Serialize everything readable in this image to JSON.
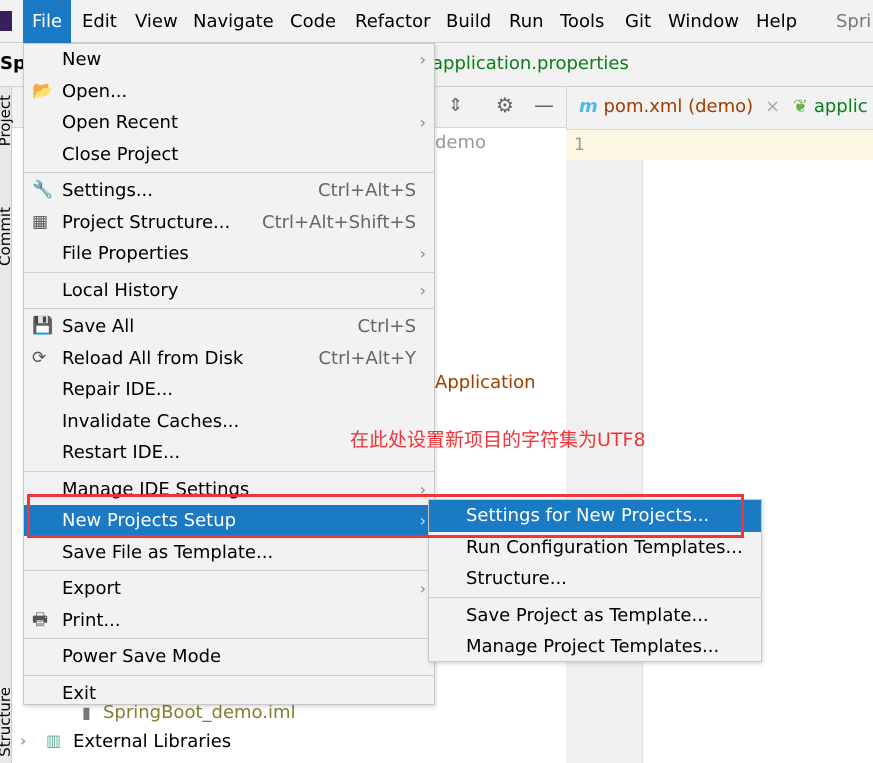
{
  "menubar": {
    "items": [
      "File",
      "Edit",
      "View",
      "Navigate",
      "Code",
      "Refactor",
      "Build",
      "Run",
      "Tools",
      "Git",
      "Window",
      "Help"
    ],
    "active": "File",
    "project_title": "Spri"
  },
  "navbar": {
    "project": "Spr",
    "file": "application.properties"
  },
  "editor": {
    "tabs": [
      {
        "label": "pom.xml (demo)",
        "icon": "maven-m-icon"
      },
      {
        "label": "applic",
        "icon": "spring-leaf-icon"
      }
    ],
    "line_number": "1"
  },
  "side_strip": {
    "labels": [
      "Project",
      "Commit",
      "Structure"
    ]
  },
  "tree": {
    "demo": "demo",
    "application": "Application",
    "iml": "SpringBoot_demo.iml",
    "external": "External Libraries"
  },
  "file_menu": {
    "items": [
      {
        "label": "New",
        "arrow": true
      },
      {
        "label": "Open...",
        "icon": "folder-open-icon"
      },
      {
        "label": "Open Recent",
        "arrow": true
      },
      {
        "label": "Close Project"
      },
      {
        "sep": true
      },
      {
        "label": "Settings...",
        "shortcut": "Ctrl+Alt+S",
        "icon": "wrench-icon"
      },
      {
        "label": "Project Structure...",
        "shortcut": "Ctrl+Alt+Shift+S",
        "icon": "project-structure-icon"
      },
      {
        "label": "File Properties",
        "arrow": true
      },
      {
        "sep": true
      },
      {
        "label": "Local History",
        "arrow": true
      },
      {
        "sep": true
      },
      {
        "label": "Save All",
        "shortcut": "Ctrl+S",
        "icon": "save-icon"
      },
      {
        "label": "Reload All from Disk",
        "shortcut": "Ctrl+Alt+Y",
        "icon": "reload-icon"
      },
      {
        "label": "Repair IDE..."
      },
      {
        "label": "Invalidate Caches..."
      },
      {
        "label": "Restart IDE..."
      },
      {
        "sep": true
      },
      {
        "label": "Manage IDE Settings",
        "arrow": true
      },
      {
        "label": "New Projects Setup",
        "arrow": true,
        "highlighted": true
      },
      {
        "label": "Save File as Template..."
      },
      {
        "sep": true
      },
      {
        "label": "Export",
        "arrow": true
      },
      {
        "label": "Print...",
        "icon": "printer-icon"
      },
      {
        "sep": true
      },
      {
        "label": "Power Save Mode"
      },
      {
        "sep": true
      },
      {
        "label": "Exit"
      }
    ]
  },
  "submenu": {
    "items": [
      {
        "label": "Settings for New Projects...",
        "highlighted": true
      },
      {
        "label": "Run Configuration Templates..."
      },
      {
        "label": "Structure..."
      },
      {
        "sep": true
      },
      {
        "label": "Save Project as Template..."
      },
      {
        "label": "Manage Project Templates..."
      }
    ]
  },
  "annotation": {
    "text": "在此处设置新项目的字符集为UTF8",
    "color": "#f0353a"
  },
  "colors": {
    "accent": "#1b7ac4",
    "green_file": "#0a7d1a"
  }
}
